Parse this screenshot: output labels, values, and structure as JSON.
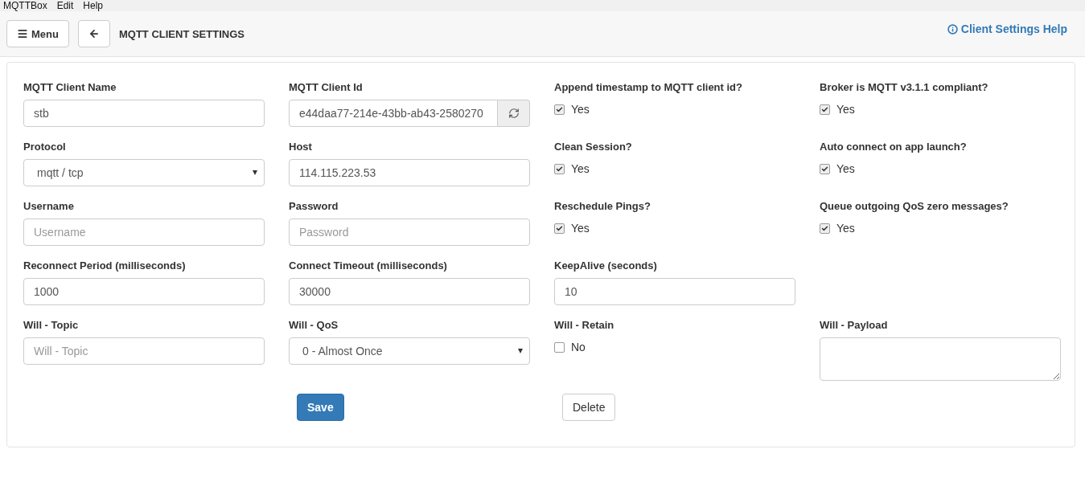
{
  "menubar": [
    "MQTTBox",
    "Edit",
    "Help"
  ],
  "header": {
    "menu_button": "Menu",
    "title": "MQTT CLIENT SETTINGS",
    "help_link": "Client Settings Help"
  },
  "rows": [
    [
      {
        "kind": "text",
        "label": "MQTT Client Name",
        "value": "stb"
      },
      {
        "kind": "id",
        "label": "MQTT Client Id",
        "value": "e44daa77-214e-43bb-ab43-2580270"
      },
      {
        "kind": "checkbox",
        "label": "Append timestamp to MQTT client id?",
        "option": "Yes",
        "checked": true
      },
      {
        "kind": "checkbox",
        "label": "Broker is MQTT v3.1.1 compliant?",
        "option": "Yes",
        "checked": true
      }
    ],
    [
      {
        "kind": "select",
        "label": "Protocol",
        "value": "mqtt / tcp"
      },
      {
        "kind": "text",
        "label": "Host",
        "value": "114.115.223.53"
      },
      {
        "kind": "checkbox",
        "label": "Clean Session?",
        "option": "Yes",
        "checked": true
      },
      {
        "kind": "checkbox",
        "label": "Auto connect on app launch?",
        "option": "Yes",
        "checked": true
      }
    ],
    [
      {
        "kind": "text",
        "label": "Username",
        "placeholder": "Username"
      },
      {
        "kind": "text",
        "label": "Password",
        "placeholder": "Password"
      },
      {
        "kind": "checkbox",
        "label": "Reschedule Pings?",
        "option": "Yes",
        "checked": true
      },
      {
        "kind": "checkbox",
        "label": "Queue outgoing QoS zero messages?",
        "option": "Yes",
        "checked": true
      }
    ],
    [
      {
        "kind": "text",
        "label": "Reconnect Period (milliseconds)",
        "value": "1000"
      },
      {
        "kind": "text",
        "label": "Connect Timeout (milliseconds)",
        "value": "30000"
      },
      {
        "kind": "text",
        "label": "KeepAlive (seconds)",
        "value": "10"
      }
    ],
    [
      {
        "kind": "text",
        "label": "Will - Topic",
        "placeholder": "Will - Topic"
      },
      {
        "kind": "select",
        "label": "Will - QoS",
        "value": "0 - Almost Once"
      },
      {
        "kind": "checkbox",
        "label": "Will - Retain",
        "option": "No",
        "checked": false
      },
      {
        "kind": "textarea",
        "label": "Will - Payload"
      }
    ]
  ],
  "buttons": [
    {
      "kind": "primary",
      "label": "Save"
    },
    {
      "kind": "default",
      "label": "Delete"
    }
  ]
}
